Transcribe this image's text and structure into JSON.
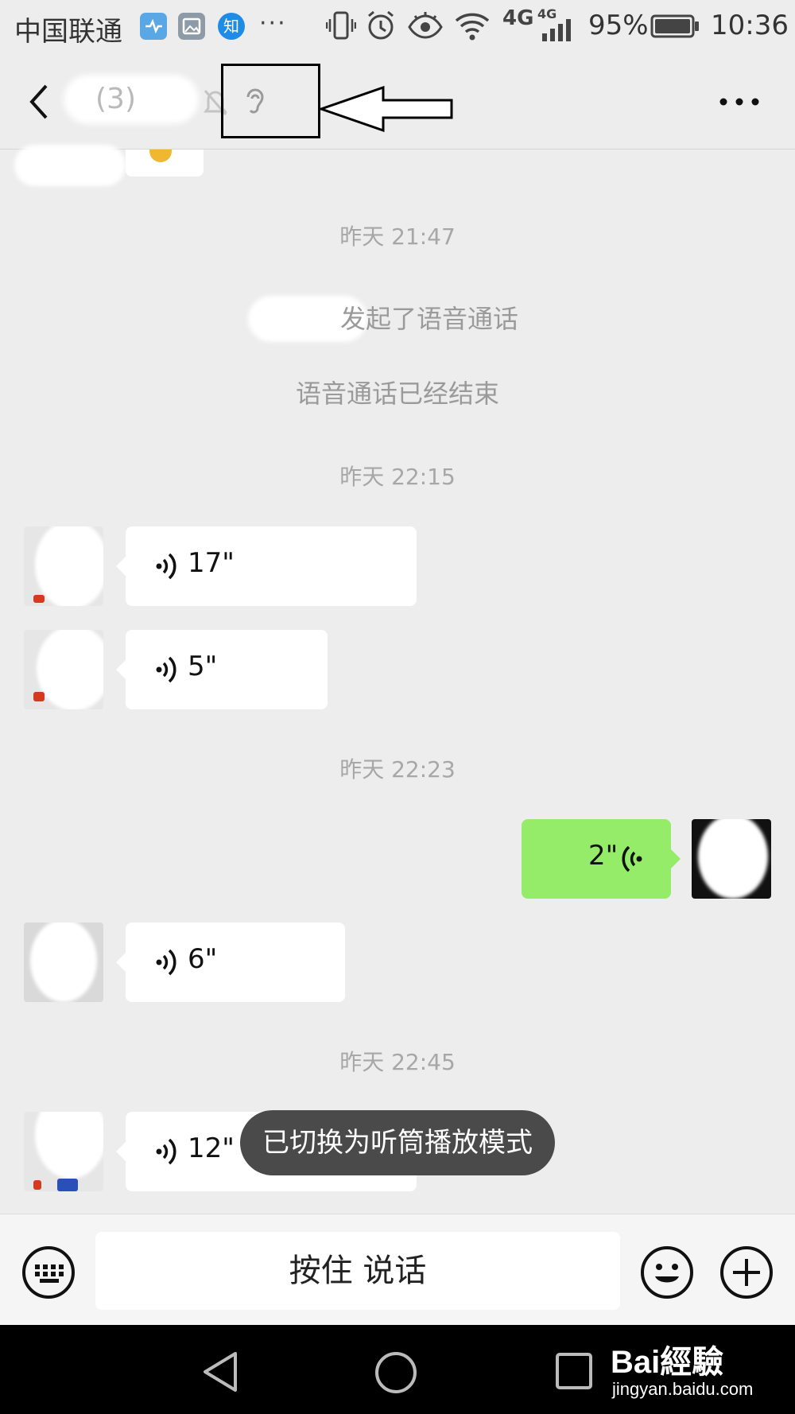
{
  "status_bar": {
    "carrier": "中国联通",
    "app_icons": [
      "health-icon",
      "gallery-icon",
      "zhihu-icon"
    ],
    "zhihu_glyph": "知",
    "overflow": "···",
    "network": "4G",
    "network2": "4G",
    "battery": "95%",
    "time": "10:36"
  },
  "header": {
    "chat_title": "",
    "title_count": "(3)",
    "icons": [
      "back-icon",
      "mute-bell-icon",
      "earpiece-icon",
      "more-icon"
    ]
  },
  "messages": {
    "ts1": "昨天 21:47",
    "call_started": "发起了语音通话",
    "call_ended": "语音通话已经结束",
    "ts2": "昨天 22:15",
    "voice1": "17\"",
    "voice2": "5\"",
    "ts3": "昨天 22:23",
    "voice3": "2\"",
    "voice4": "6\"",
    "ts4": "昨天 22:45",
    "voice5": "12\""
  },
  "toast": "已切换为听筒播放模式",
  "input_bar": {
    "hold_to_talk": "按住 说话"
  },
  "watermark": {
    "logo": "Bai經驗",
    "url": "jingyan.baidu.com"
  },
  "colors": {
    "background": "#ededed",
    "bubble_in": "#ffffff",
    "bubble_out": "#95ec69",
    "toast": "#4a4a4a"
  }
}
